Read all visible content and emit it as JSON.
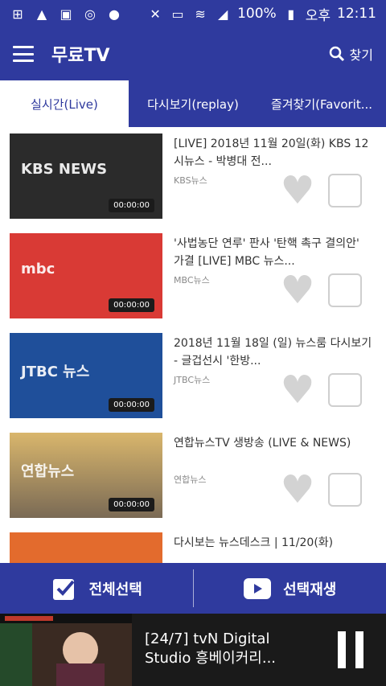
{
  "statusbar": {
    "battery": "100%",
    "period": "오후",
    "time": "12:11"
  },
  "appbar": {
    "title": "무료TV",
    "search_label": "찾기"
  },
  "tabs": [
    {
      "label": "실시간(Live)",
      "active": true
    },
    {
      "label": "다시보기(replay)",
      "active": false
    },
    {
      "label": "즐겨찾기(Favorit...",
      "active": false
    }
  ],
  "items": [
    {
      "title": "[LIVE] 2018년 11월 20일(화) KBS 12시뉴스 - 박병대 전...",
      "source": "KBS뉴스",
      "logo": "KBS NEWS",
      "badge": "00:00:00",
      "thumb_color": "#2b2b2b"
    },
    {
      "title": "'사법농단 연루' 판사 '탄핵 촉구 결의안' 가결 [LIVE] MBC 뉴스...",
      "source": "MBC뉴스",
      "logo": "mbc",
      "badge": "00:00:00",
      "thumb_color": "#d93a35"
    },
    {
      "title": "2018년 11월 18일 (일) 뉴스룸 다시보기 - 글겁선시 '한방...",
      "source": "JTBC뉴스",
      "logo": "JTBC 뉴스",
      "badge": "00:00:00",
      "thumb_color": "#1f4f9a"
    },
    {
      "title": "연합뉴스TV 생방송 (LIVE & NEWS)",
      "source": "연합뉴스",
      "logo": "연합뉴스",
      "badge": "00:00:00",
      "thumb_color": "#c9a55a"
    },
    {
      "title": "다시보는 뉴스데스크 | 11/20(화)",
      "source": "",
      "logo": "",
      "badge": "",
      "thumb_color": "#e36b2d"
    }
  ],
  "actionbar": {
    "select_all": "전체선택",
    "play_selected": "선택재생"
  },
  "player": {
    "title": "[24/7] tvN Digital Studio 흥베이커리..."
  }
}
